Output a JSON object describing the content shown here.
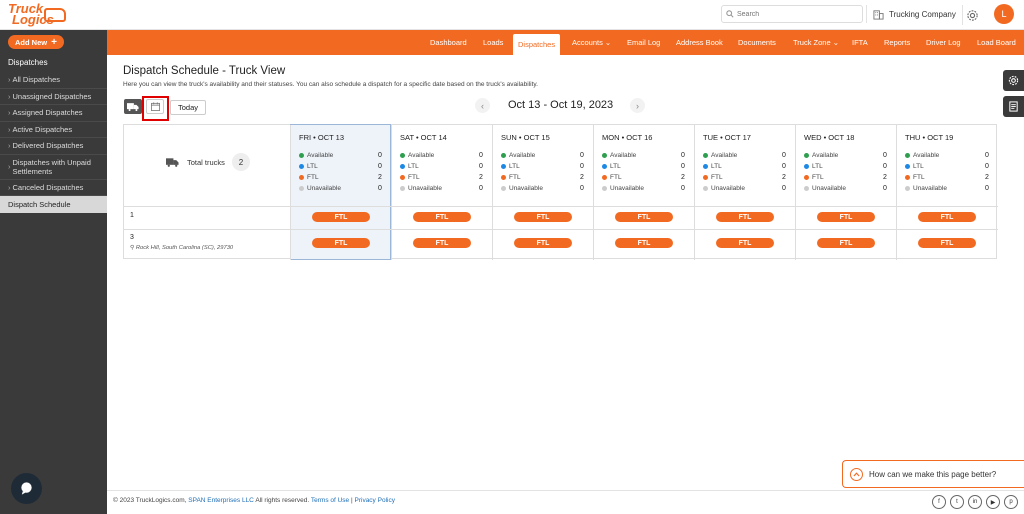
{
  "header": {
    "logo_line1": "Truck",
    "logo_line2": "Logics",
    "search_placeholder": "Search",
    "company": "Trucking Company",
    "avatar_initial": "L"
  },
  "sidebar": {
    "add_new": "Add New",
    "section_title": "Dispatches",
    "items": [
      {
        "label": "All Dispatches"
      },
      {
        "label": "Unassigned Dispatches"
      },
      {
        "label": "Assigned Dispatches"
      },
      {
        "label": "Active Dispatches"
      },
      {
        "label": "Delivered Dispatches"
      },
      {
        "label": "Dispatches with Unpaid Settlements"
      },
      {
        "label": "Canceled Dispatches"
      },
      {
        "label": "Dispatch Schedule"
      }
    ]
  },
  "nav": {
    "items": [
      {
        "label": "Dashboard"
      },
      {
        "label": "Loads"
      },
      {
        "label": "Dispatches"
      },
      {
        "label": "Accounts ⌄"
      },
      {
        "label": "Email Log"
      },
      {
        "label": "Address Book"
      },
      {
        "label": "Documents"
      },
      {
        "label": "Truck Zone ⌄"
      },
      {
        "label": "IFTA"
      },
      {
        "label": "Reports"
      },
      {
        "label": "Driver Log"
      },
      {
        "label": "Load Board"
      }
    ]
  },
  "page": {
    "title": "Dispatch Schedule - Truck View",
    "subtitle": "Here you can view the truck's availability and their statuses. You can also schedule a dispatch for a specific date based on the truck's availability.",
    "today": "Today",
    "date_range": "Oct 13 - Oct 19, 2023",
    "total_trucks_label": "Total trucks",
    "total_trucks": "2"
  },
  "status_labels": {
    "available": "Available",
    "ltl": "LTL",
    "ftl": "FTL",
    "unavailable": "Unavailable"
  },
  "colors": {
    "brand": "#f26a21",
    "available": "#2e9e4f",
    "ltl": "#1e88e5",
    "ftl": "#f26a21",
    "unavailable": "#cccccc"
  },
  "days": [
    {
      "label": "FRI • OCT 13",
      "available": "0",
      "ltl": "0",
      "ftl": "2",
      "unavailable": "0"
    },
    {
      "label": "SAT • OCT 14",
      "available": "0",
      "ltl": "0",
      "ftl": "2",
      "unavailable": "0"
    },
    {
      "label": "SUN • OCT 15",
      "available": "0",
      "ltl": "0",
      "ftl": "2",
      "unavailable": "0"
    },
    {
      "label": "MON • OCT 16",
      "available": "0",
      "ltl": "0",
      "ftl": "2",
      "unavailable": "0"
    },
    {
      "label": "TUE • OCT 17",
      "available": "0",
      "ltl": "0",
      "ftl": "2",
      "unavailable": "0"
    },
    {
      "label": "WED • OCT 18",
      "available": "0",
      "ltl": "0",
      "ftl": "2",
      "unavailable": "0"
    },
    {
      "label": "THU • OCT 19",
      "available": "0",
      "ltl": "0",
      "ftl": "2",
      "unavailable": "0"
    }
  ],
  "trucks": [
    {
      "number": "1",
      "location": "",
      "status": "FTL"
    },
    {
      "number": "3",
      "location": "Rock Hill, South Carolina (SC), 29730",
      "status": "FTL"
    }
  ],
  "footer": {
    "copyright_prefix": "© 2023 TruckLogics.com,",
    "span": "SPAN Enterprises LLC",
    "rights": "All rights reserved.",
    "terms": "Terms of Use",
    "sep": "|",
    "privacy": "Privacy Policy"
  },
  "feedback": "How can we make this page better?"
}
